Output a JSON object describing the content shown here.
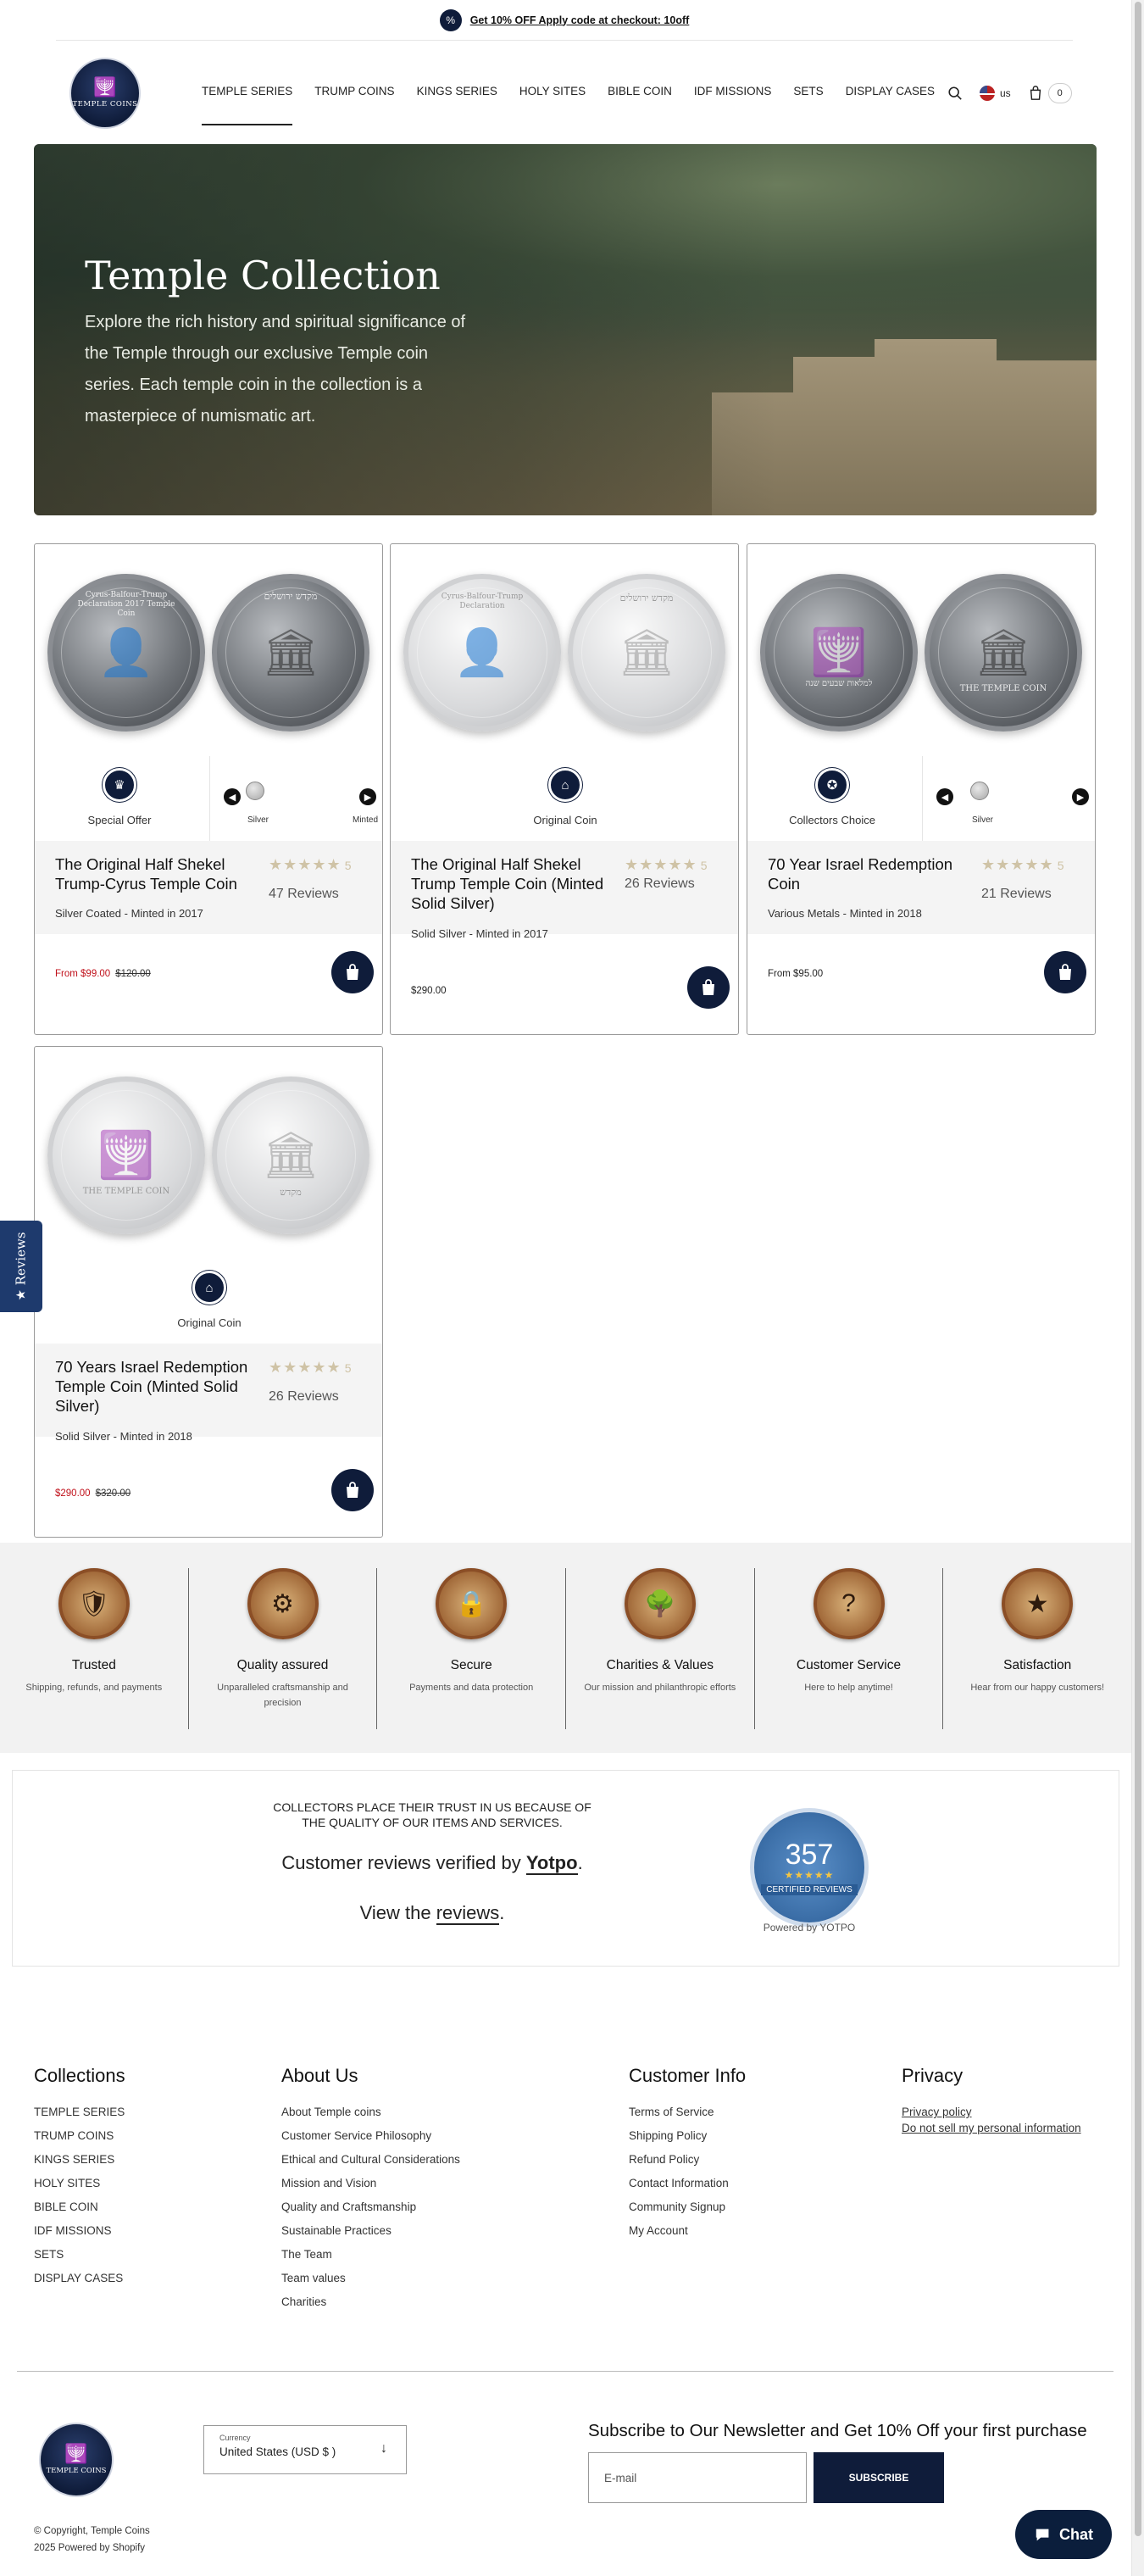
{
  "announcement": {
    "text": "Get 10% OFF Apply code at checkout: 10off"
  },
  "logo": {
    "text": "TEMPLE COINS"
  },
  "nav": {
    "items": [
      {
        "label": "TEMPLE SERIES"
      },
      {
        "label": "TRUMP COINS"
      },
      {
        "label": "KINGS SERIES"
      },
      {
        "label": "HOLY SITES"
      },
      {
        "label": "BIBLE COIN"
      },
      {
        "label": "IDF MISSIONS"
      },
      {
        "label": "SETS"
      },
      {
        "label": "DISPLAY CASES"
      }
    ],
    "region": "us",
    "cart_count": "0"
  },
  "hero": {
    "title": "Temple Collection",
    "text": "Explore the rich history and spiritual significance of the Temple through our exclusive Temple coin series. Each temple coin in the collection is a masterpiece of numismatic art."
  },
  "products": [
    {
      "badge": "Special Offer",
      "swatches": [
        "Silver",
        "Minted"
      ],
      "title": "The Original Half Shekel Trump-Cyrus Temple Coin",
      "rating": "5",
      "reviews": "47 Reviews",
      "subtitle": "Silver Coated - Minted in 2017",
      "price_sale": "From $99.00",
      "price_compare": "$120.00",
      "coin_front": "Cyrus-Balfour-Trump Declaration 2017 Temple Coin",
      "coin_back": "מקדש ירושלים"
    },
    {
      "badge": "Original Coin",
      "title": "The Original Half Shekel Trump Temple Coin (Minted Solid Silver)",
      "rating": "5",
      "reviews": "26 Reviews",
      "subtitle": "Solid Silver - Minted in 2017",
      "price": "$290.00",
      "coin_front": "Cyrus-Balfour-Trump Declaration",
      "coin_back": "מקדש ירושלים"
    },
    {
      "badge": "Collectors Choice",
      "swatches": [
        "Silver"
      ],
      "title": "70 Year Israel Redemption Coin",
      "rating": "5",
      "reviews": "21 Reviews",
      "subtitle": "Various Metals - Minted in 2018",
      "price": "From $95.00",
      "coin_front": "למלאות שבעים שנה",
      "coin_back": "THE TEMPLE COIN"
    },
    {
      "badge": "Original Coin",
      "title": "70 Years Israel Redemption Temple Coin (Minted Solid Silver)",
      "rating": "5",
      "reviews": "26 Reviews",
      "subtitle": "Solid Silver - Minted in 2018",
      "price_sale": "$290.00",
      "price_compare": "$320.00",
      "coin_front": "THE TEMPLE COIN",
      "coin_back": "מקדש"
    }
  ],
  "reviews_tab": "★ Reviews",
  "trust": [
    {
      "title": "Trusted",
      "text": "Shipping, refunds, and payments"
    },
    {
      "title": "Quality assured",
      "text": "Unparalleled craftsmanship and precision"
    },
    {
      "title": "Secure",
      "text": "Payments and data protection"
    },
    {
      "title": "Charities & Values",
      "text": "Our mission and philanthropic efforts"
    },
    {
      "title": "Customer Service",
      "text": "Here to help anytime!"
    },
    {
      "title": "Satisfaction",
      "text": "Hear from our happy customers!"
    }
  ],
  "yotpo": {
    "headline": "COLLECTORS PLACE THEIR TRUST IN US BECAUSE OF THE QUALITY OF OUR ITEMS AND SERVICES.",
    "verified_prefix": "Customer reviews verified by",
    "verified_brand": "Yotpo",
    "view_prefix": "View the",
    "view_link": "reviews",
    "count": "357",
    "certified": "CERTIFIED REVIEWS",
    "powered": "Powered by YOTPO"
  },
  "footer": {
    "collections": {
      "title": "Collections",
      "items": [
        "TEMPLE SERIES",
        "TRUMP COINS",
        "KINGS SERIES",
        "HOLY SITES",
        "BIBLE COIN",
        "IDF MISSIONS",
        "SETS",
        "DISPLAY CASES"
      ]
    },
    "about": {
      "title": "About Us",
      "items": [
        "About Temple coins",
        "Customer Service Philosophy",
        "Ethical and Cultural Considerations",
        "Mission and Vision",
        "Quality and Craftsmanship",
        "Sustainable Practices",
        "The Team",
        "Team values",
        "Charities"
      ]
    },
    "info": {
      "title": "Customer Info",
      "items": [
        "Terms of Service",
        "Shipping Policy",
        "Refund Policy",
        "Contact Information",
        "Community Signup",
        "My Account"
      ]
    },
    "privacy": {
      "title": "Privacy",
      "items": [
        "Privacy policy",
        "Do not sell my personal information"
      ]
    },
    "currency_label": "Currency",
    "currency_value": "United States (USD $ )",
    "newsletter_title": "Subscribe to Our Newsletter and Get 10% Off your first purchase",
    "email_placeholder": "E-mail",
    "subscribe_label": "SUBSCRIBE",
    "copyright": "© Copyright, Temple Coins",
    "powered": "2025  Powered by Shopify",
    "chat_label": "Chat"
  }
}
